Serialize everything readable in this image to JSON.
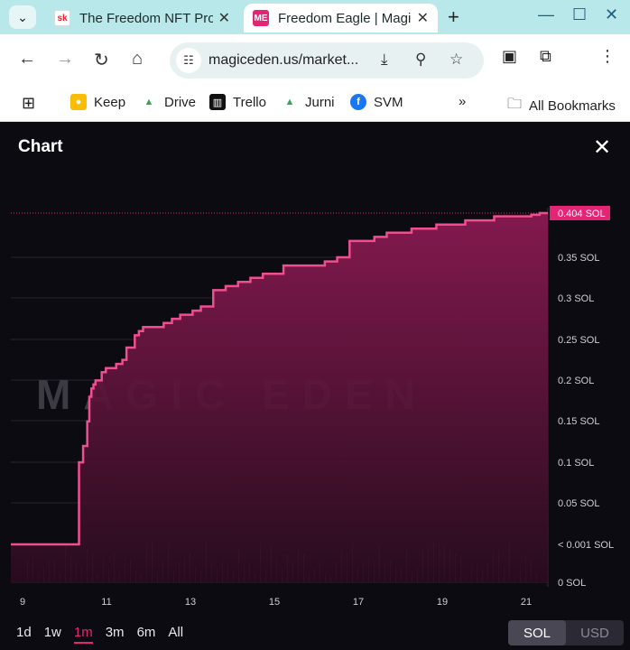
{
  "browser": {
    "tabs": [
      {
        "title": "The Freedom NFT Pro",
        "favicon": "sk",
        "active": false
      },
      {
        "title": "Freedom Eagle | Magi",
        "favicon": "ME",
        "active": true
      }
    ],
    "url": "magiceden.us/market...",
    "bookmarks": [
      "Keep",
      "Drive",
      "Trello",
      "Jurni",
      "SVM"
    ],
    "all_bookmarks_label": "All Bookmarks",
    "more_label": "»"
  },
  "panel": {
    "title": "Chart",
    "close_label": "✕",
    "watermark": "MAGIC EDEN",
    "ranges": [
      "1d",
      "1w",
      "1m",
      "3m",
      "6m",
      "All"
    ],
    "active_range": "1m",
    "currencies": [
      "SOL",
      "USD"
    ],
    "active_currency": "SOL"
  },
  "colors": {
    "accent": "#e42575",
    "line": "#ef4f8f",
    "background": "#0d0b12"
  },
  "chart_data": {
    "type": "area",
    "title": "",
    "xlabel": "",
    "ylabel": "",
    "x_ticks": [
      "9",
      "11",
      "13",
      "15",
      "17",
      "19",
      "21"
    ],
    "y_ticks": [
      "0 SOL",
      "< 0.001 SOL",
      "0.05 SOL",
      "0.1 SOL",
      "0.15 SOL",
      "0.2 SOL",
      "0.25 SOL",
      "0.3 SOL",
      "0.35 SOL"
    ],
    "current_value_label": "0.404 SOL",
    "current_value": 0.404,
    "x_range": [
      8.7,
      21.7
    ],
    "y_range": [
      0,
      0.404
    ],
    "series": [
      {
        "x": [
          8.7,
          10.3,
          10.35,
          10.45,
          10.55,
          10.6,
          10.65,
          10.7,
          10.75,
          10.9,
          11.0,
          11.1,
          11.25,
          11.4,
          11.5,
          11.6,
          11.7,
          11.8,
          11.9,
          12.2,
          12.4,
          12.6,
          12.8,
          13.1,
          13.3,
          13.6,
          13.9,
          14.2,
          14.5,
          14.8,
          15.3,
          15.8,
          16.3,
          16.6,
          16.9,
          17.5,
          17.8,
          18.4,
          19.0,
          19.7,
          20.4,
          21.0,
          21.3,
          21.5,
          21.6
        ],
        "y": [
          0.0,
          0.0,
          0.1,
          0.12,
          0.15,
          0.18,
          0.19,
          0.195,
          0.2,
          0.21,
          0.215,
          0.215,
          0.22,
          0.225,
          0.24,
          0.24,
          0.255,
          0.26,
          0.265,
          0.265,
          0.27,
          0.275,
          0.28,
          0.285,
          0.29,
          0.31,
          0.315,
          0.32,
          0.325,
          0.33,
          0.34,
          0.34,
          0.345,
          0.35,
          0.37,
          0.375,
          0.38,
          0.385,
          0.39,
          0.395,
          0.4,
          0.4,
          0.402,
          0.404,
          0.404
        ]
      }
    ],
    "grid": true,
    "legend": "none"
  }
}
